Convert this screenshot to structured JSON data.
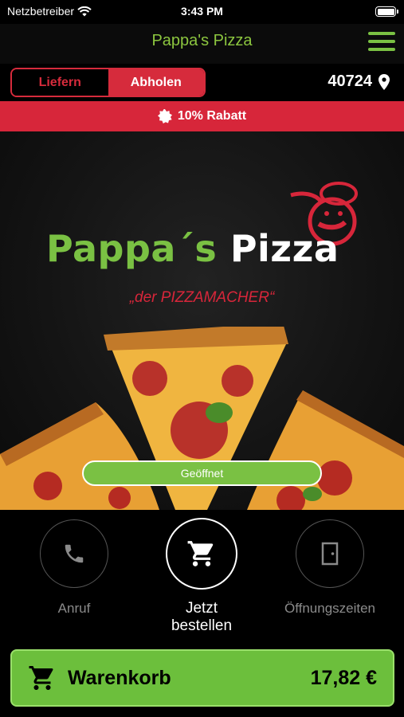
{
  "status_bar": {
    "carrier": "Netzbetreiber",
    "time": "3:43 PM"
  },
  "navbar": {
    "title": "Pappa's Pizza"
  },
  "order_mode": {
    "deliver_label": "Liefern",
    "pickup_label": "Abholen",
    "selected": "Abholen"
  },
  "location": {
    "zip": "40724"
  },
  "discount": {
    "text": "10% Rabatt"
  },
  "hero": {
    "brand_part1": "Pappa´s",
    "brand_part2": "Pizza",
    "tagline": "„der PIZZAMACHER“",
    "open_status": "Geöffnet"
  },
  "actions": [
    {
      "label": "Anruf",
      "icon": "phone-icon"
    },
    {
      "label": "Jetzt bestellen",
      "icon": "cart-icon"
    },
    {
      "label": "Öffnungszeiten",
      "icon": "door-icon"
    }
  ],
  "cart": {
    "label": "Warenkorb",
    "total": "17,82 €"
  },
  "colors": {
    "green": "#7ac143",
    "red": "#d7263a",
    "background": "#000000"
  }
}
